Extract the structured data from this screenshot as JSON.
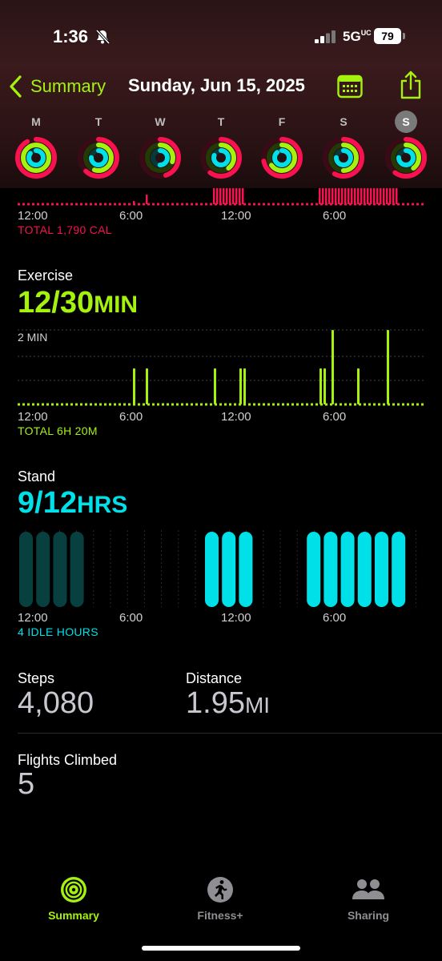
{
  "status": {
    "time": "1:36",
    "network": "5G",
    "network_sup": "UC",
    "battery": "79"
  },
  "nav": {
    "back_label": "Summary",
    "date": "Sunday, Jun 15, 2025"
  },
  "colors": {
    "move": "#fa114f",
    "exercise": "#a6f20f",
    "stand": "#00e0e8",
    "accent": "#a6f20f"
  },
  "week": [
    {
      "letter": "M",
      "selected": false
    },
    {
      "letter": "T",
      "selected": false
    },
    {
      "letter": "W",
      "selected": false
    },
    {
      "letter": "T",
      "selected": false
    },
    {
      "letter": "F",
      "selected": false
    },
    {
      "letter": "S",
      "selected": false
    },
    {
      "letter": "S",
      "selected": true
    }
  ],
  "move": {
    "axis": [
      "12:00",
      "6:00",
      "12:00",
      "6:00"
    ],
    "total": "TOTAL 1,790 CAL"
  },
  "exercise": {
    "title": "Exercise",
    "value": "12/30",
    "unit": "MIN",
    "y_label": "2 MIN",
    "axis": [
      "12:00",
      "6:00",
      "12:00",
      "6:00"
    ],
    "total": "TOTAL 6H 20M"
  },
  "stand": {
    "title": "Stand",
    "value": "9/12",
    "unit": "HRS",
    "axis": [
      "12:00",
      "6:00",
      "12:00",
      "6:00"
    ],
    "idle": "4 IDLE HOURS"
  },
  "steps": {
    "label": "Steps",
    "value": "4,080"
  },
  "distance": {
    "label": "Distance",
    "value": "1.95",
    "unit": "MI"
  },
  "flights": {
    "label": "Flights Climbed",
    "value": "5"
  },
  "tabs": [
    {
      "label": "Summary",
      "icon": "activity-rings-icon",
      "active": true
    },
    {
      "label": "Fitness+",
      "icon": "runner-icon",
      "active": false
    },
    {
      "label": "Sharing",
      "icon": "people-icon",
      "active": false
    }
  ]
}
